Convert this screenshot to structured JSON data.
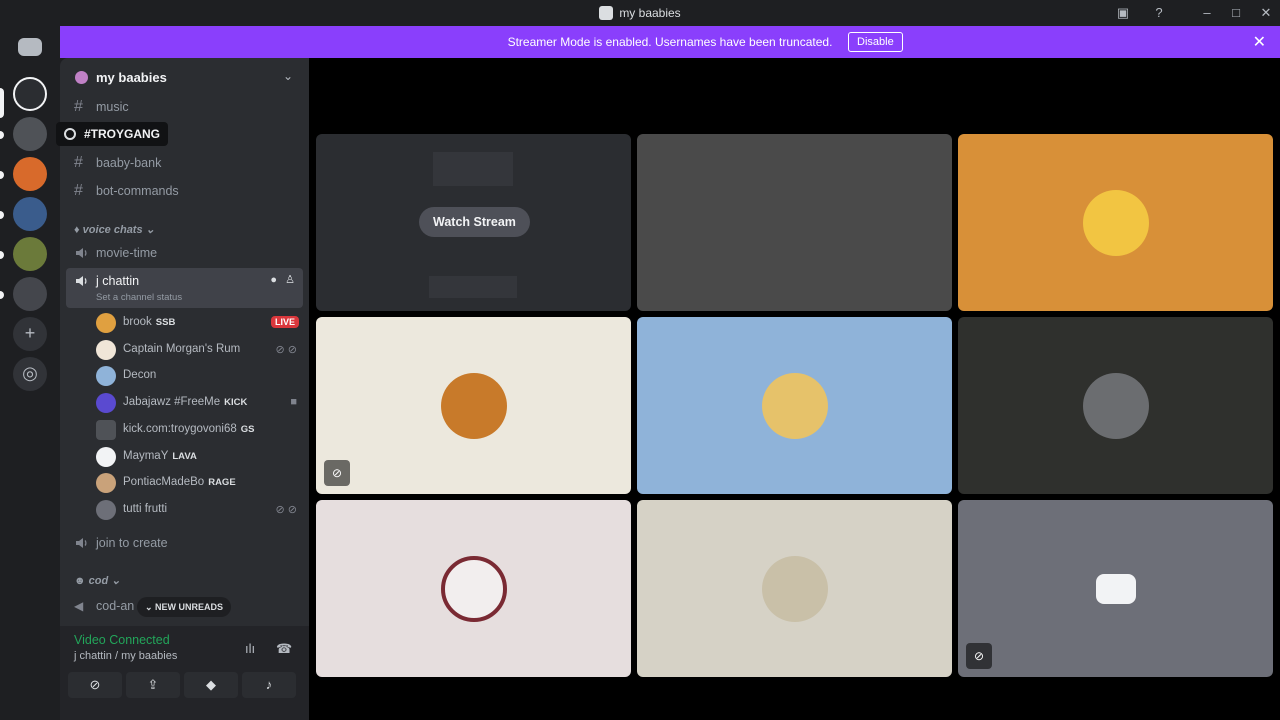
{
  "window": {
    "title": "my baabies"
  },
  "banner": {
    "message": "Streamer Mode is enabled. Usernames have been truncated.",
    "disable_label": "Disable"
  },
  "server": {
    "name": "my baabies"
  },
  "tooltip": {
    "label": "#TROYGANG"
  },
  "channels": {
    "music": "music",
    "baaby_bank": "baaby-bank",
    "bot_commands": "bot-commands",
    "voice_category": "voice chats",
    "movie_time": "movie-time",
    "j_chattin": "j chattin",
    "channel_status": "Set a channel status",
    "join_to_create": "join to create",
    "cod_category": "cod",
    "cod_an": "cod-an"
  },
  "members": [
    {
      "name": "brook",
      "tag": "SSB",
      "badge": "LIVE"
    },
    {
      "name": "Captain Morgan's Rum",
      "tag": ""
    },
    {
      "name": "Decon",
      "tag": ""
    },
    {
      "name": "Jabajawz #FreeMe",
      "tag": "KICK"
    },
    {
      "name": "kick.com:troygovoni68",
      "tag": "GS"
    },
    {
      "name": "MaymaY",
      "tag": "LAVA"
    },
    {
      "name": "PontiacMadeBo",
      "tag": "RAGE"
    },
    {
      "name": "tutti frutti",
      "tag": ""
    }
  ],
  "unreads": {
    "label": "NEW UNREADS"
  },
  "voice": {
    "status": "Video Connected",
    "location": "j chattin / my baabies"
  },
  "stream": {
    "watch_label": "Watch Stream"
  },
  "colors": {
    "accent": "#8a3ffc",
    "live": "#da373c",
    "connected": "#23a55a"
  }
}
